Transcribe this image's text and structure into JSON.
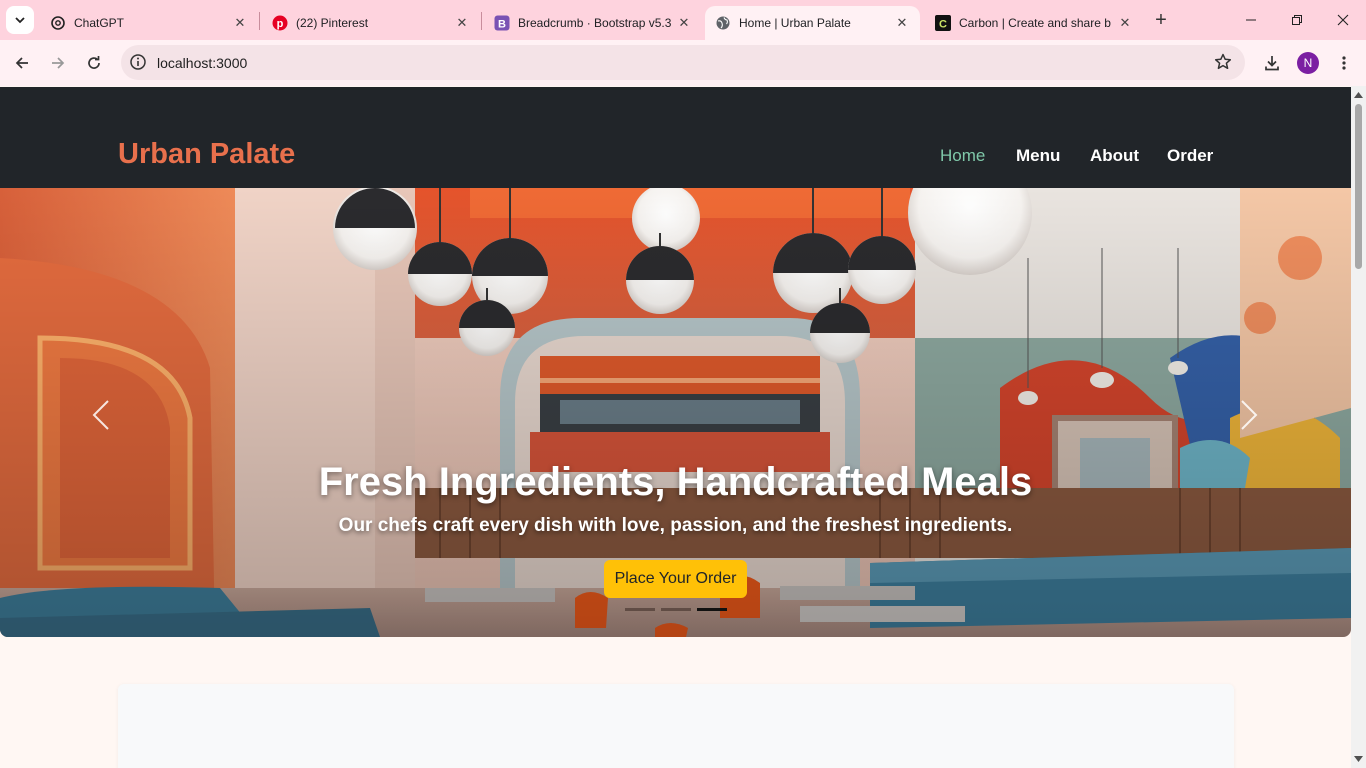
{
  "browser": {
    "tabs": [
      {
        "title": "ChatGPT",
        "favicon": "chatgpt-icon"
      },
      {
        "title": "(22) Pinterest",
        "favicon": "pinterest-icon"
      },
      {
        "title": "Breadcrumb · Bootstrap v5.3",
        "favicon": "bootstrap-icon"
      },
      {
        "title": "Home | Urban Palate",
        "favicon": "globe-icon",
        "active": true
      },
      {
        "title": "Carbon | Create and share b",
        "favicon": "carbon-icon"
      }
    ],
    "url": "localhost:3000",
    "profile_initial": "N",
    "accent": "#fed3de"
  },
  "site": {
    "brand": "Urban Palate",
    "brand_color": "#e8704c",
    "nav": [
      "Home",
      "Menu",
      "About",
      "Order"
    ],
    "active_nav": "Home",
    "hero": {
      "title": "Fresh Ingredients, Handcrafted Meals",
      "subtitle": "Our chefs craft every dish with love, passion, and the freshest ingredients.",
      "cta": "Place Your Order",
      "cta_color": "#ffc107",
      "slide_count": 3,
      "active_slide": 3
    }
  }
}
